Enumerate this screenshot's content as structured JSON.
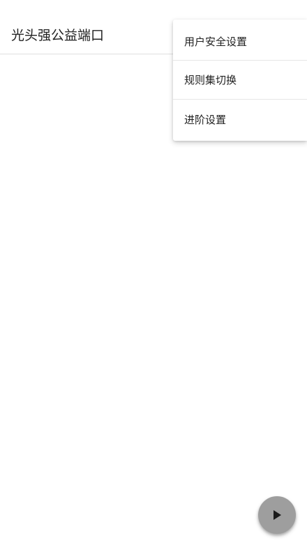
{
  "app_bar": {
    "title": "光头强公益端口"
  },
  "overflow_menu": {
    "items": [
      {
        "label": "用户安全设置"
      },
      {
        "label": "规则集切换"
      },
      {
        "label": "进阶设置"
      }
    ]
  },
  "fab": {
    "icon": "play-icon"
  },
  "colors": {
    "background": "#ffffff",
    "fab": "#9e9e9e",
    "text": "#212121"
  }
}
